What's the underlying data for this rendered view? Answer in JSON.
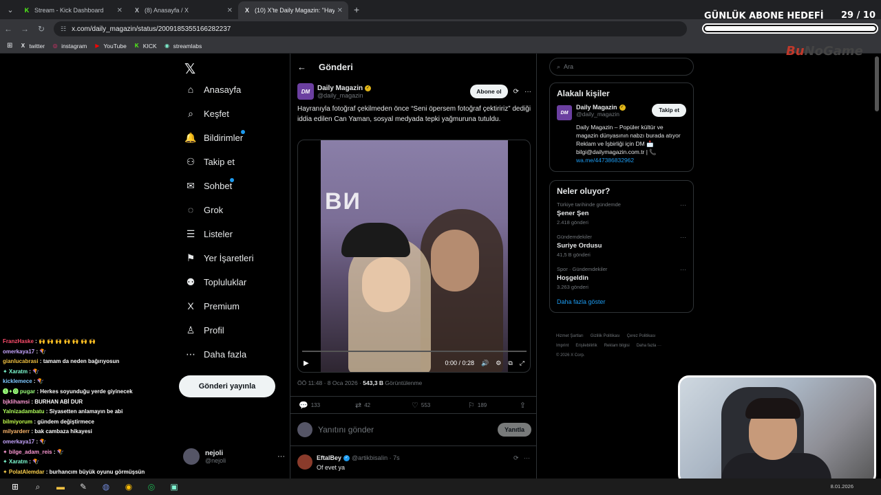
{
  "browser": {
    "tabs": [
      {
        "title": "Stream - Kick Dashboard",
        "icon": "K"
      },
      {
        "title": "(8) Anasayfa / X",
        "icon": "X"
      },
      {
        "title": "(10) X'te Daily Magazin: \"Hayra",
        "icon": "X"
      }
    ],
    "url": "x.com/daily_magazin/status/2009185355166282237",
    "bookmarks": [
      {
        "label": "twitter",
        "icon": "X"
      },
      {
        "label": "instagram",
        "icon": "◎"
      },
      {
        "label": "YouTube",
        "icon": "▶"
      },
      {
        "label": "KICK",
        "icon": "K"
      },
      {
        "label": "streamlabs",
        "icon": "◉"
      }
    ]
  },
  "nav": {
    "items": [
      {
        "label": "Anasayfa",
        "icon": "⌂"
      },
      {
        "label": "Keşfet",
        "icon": "⌕"
      },
      {
        "label": "Bildirimler",
        "icon": "🔔"
      },
      {
        "label": "Takip et",
        "icon": "⚇"
      },
      {
        "label": "Sohbet",
        "icon": "✉"
      },
      {
        "label": "Grok",
        "icon": "◌"
      },
      {
        "label": "Listeler",
        "icon": "☰"
      },
      {
        "label": "Yer İşaretleri",
        "icon": "⚑"
      },
      {
        "label": "Topluluklar",
        "icon": "⚉"
      },
      {
        "label": "Premium",
        "icon": "X"
      },
      {
        "label": "Profil",
        "icon": "♙"
      },
      {
        "label": "Daha fazla",
        "icon": "⋯"
      }
    ],
    "post_button": "Gönderi yayınla",
    "account": {
      "name": "nejoli",
      "handle": "@nejoli"
    }
  },
  "post": {
    "header": "Gönderi",
    "author": "Daily Magazin",
    "handle": "@daily_magazin",
    "avatar_text": "DM",
    "subscribe": "Abone ol",
    "text": "Hayranıyla fotoğraf çekilmeden önce “Seni öpersem fotoğraf çektiririz” dediği iddia edilen Can Yaman, sosyal medyada tepki yağmuruna tutuldu.",
    "video_time": "0:00 / 0:28",
    "video_overlay": "ВИ",
    "timestamp": "ÖÖ 11:48 · 8 Oca 2026 · ",
    "views": "543,3 B",
    "views_label": " Görüntülenme",
    "stats": {
      "replies": "133",
      "reposts": "42",
      "likes": "553",
      "bookmarks": "189"
    },
    "reply_placeholder": "Yanıtını gönder",
    "reply_button": "Yanıtla",
    "comment": {
      "name": "EftalBey",
      "handle": "@artikbisaIin · 7s",
      "text": "Of evet ya"
    }
  },
  "sidebar": {
    "search_placeholder": "Ara",
    "related_title": "Alakalı kişiler",
    "related": {
      "name": "Daily Magazin",
      "handle": "@daily_magazin",
      "avatar_text": "DM",
      "follow": "Takip et",
      "bio": "Daily Magazin – Popüler kültür ve magazin dünyasının nabzı burada atıyor Reklam ve İşbirliği için DM 📩 bilgi@dailymagazin.com.tr | 📞",
      "link": "wa.me/447386832962"
    },
    "trends_title": "Neler oluyor?",
    "trends": [
      {
        "context": "Türkiye tarihinde gündemde",
        "name": "Şener Şen",
        "count": "2.418 gönderi"
      },
      {
        "context": "Gündemdekiler",
        "name": "Suriye Ordusu",
        "count": "41,5 B gönderi"
      },
      {
        "context": "Spor · Gündemdekiler",
        "name": "Hoşgeldin",
        "count": "3.263 gönderi"
      }
    ],
    "show_more": "Daha fazla göster",
    "footer": [
      "Hizmet Şartları",
      "Gizlilik Politikası",
      "Çerez Politikası",
      "Imprint",
      "Erişilebilirlik",
      "Reklam bilgisi",
      "Daha fazla ···",
      "© 2026 X Corp."
    ]
  },
  "overlay": {
    "goal_title": "GÜNLÜK ABONE HEDEFİ",
    "goal_count": "29  / 10",
    "goal_progress": 1.0,
    "brand_a": "Bu",
    "brand_b": "NoGame"
  },
  "chat": [
    {
      "user": "FranzHaske",
      "msg": "🙌 🙌 🙌 🙌 🙌 🙌 🙌",
      "color": "#ff4d6d"
    },
    {
      "user": "omerkaya17",
      "msg": "🪁",
      "color": "#c7a6ff"
    },
    {
      "user": "gianlucabrasi",
      "msg": "tamam da neden bağırıyosun",
      "color": "#f0c040"
    },
    {
      "user": "✦ Xaratm",
      "msg": "🪁",
      "color": "#7fffd4"
    },
    {
      "user": "kicklemece",
      "msg": "🪁",
      "color": "#7ec8ff"
    },
    {
      "user": "🅢✦🅞 pugar",
      "msg": "Herkes soyunduğu yerde giyinecek",
      "color": "#9aff7a"
    },
    {
      "user": "bjklihamsi",
      "msg": "BURHAN ABİ DUR",
      "color": "#ff9ad5"
    },
    {
      "user": "Yalnizadambatu",
      "msg": "Siyasetten anlamayın be abi",
      "color": "#b0ff5c"
    },
    {
      "user": "bilmiyorum",
      "msg": "gündem değiştirmece",
      "color": "#c4ff4d"
    },
    {
      "user": "milyarderr",
      "msg": "bak cambaza hikayesi",
      "color": "#ffb86c"
    },
    {
      "user": "omerkaya17",
      "msg": "🪁",
      "color": "#c7a6ff"
    },
    {
      "user": "✦ bilge_adam_reis",
      "msg": "🪁",
      "color": "#ff9ad5"
    },
    {
      "user": "✦ Xaratm",
      "msg": "🪁",
      "color": "#7fffd4"
    },
    {
      "user": "✦ PolatAlemdar",
      "msg": "burhancım büyük oyunu görmüşsün",
      "color": "#ffd24d"
    }
  ],
  "taskbar": {
    "date": "8.01.2026"
  }
}
